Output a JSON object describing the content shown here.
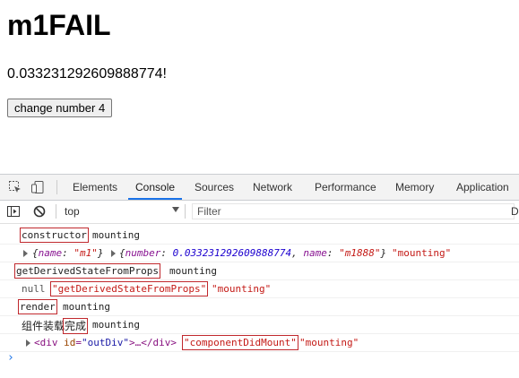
{
  "page": {
    "title": "m1FAIL",
    "number_text": "0.033231292609888774!",
    "button_label": "change number 4"
  },
  "devtools": {
    "tabs": [
      "Elements",
      "Console",
      "Sources",
      "Network",
      "Performance",
      "Memory",
      "Application"
    ],
    "active_tab": "Console",
    "context": "top",
    "filter_placeholder": "Filter",
    "cut_label": "D",
    "prompt": "›"
  },
  "console": {
    "r1": {
      "label": "constructor",
      "msg": "mounting"
    },
    "r2": {
      "o1_open": "{",
      "o1_key": "name",
      "o1_colon": ": ",
      "o1_val": "\"m1\"",
      "o1_close": "}",
      "o2_open": "{",
      "o2_key1": "number",
      "o2_colon1": ": ",
      "o2_val1": "0.033231292609888774",
      "o2_comma": ", ",
      "o2_key2": "name",
      "o2_colon2": ": ",
      "o2_val2": "\"m1888\"",
      "o2_close": "}",
      "msg": "\"mounting\""
    },
    "r3": {
      "label": "getDerivedStateFromProps",
      "msg": "mounting"
    },
    "r4": {
      "null_text": "null",
      "label": "\"getDerivedStateFromProps\"",
      "msg": "\"mounting\""
    },
    "r5": {
      "label": "render",
      "msg": "mounting"
    },
    "r6": {
      "text_a": "组件装载",
      "text_b": "完成",
      "msg": "mounting"
    },
    "r7": {
      "lt": "<",
      "tag": "div",
      "attr_name": "id",
      "eq": "=",
      "attr_val": "\"outDiv\"",
      "mid": ">…</",
      "tag2": "div",
      "gt": ">",
      "label": "\"componentDidMount\"",
      "msg": "\"mounting\""
    }
  },
  "colors": {
    "accent": "#1a73e8",
    "highlight_box": "#c0282d",
    "string": "#c41a16",
    "number": "#1c00cf",
    "key": "#881391"
  }
}
